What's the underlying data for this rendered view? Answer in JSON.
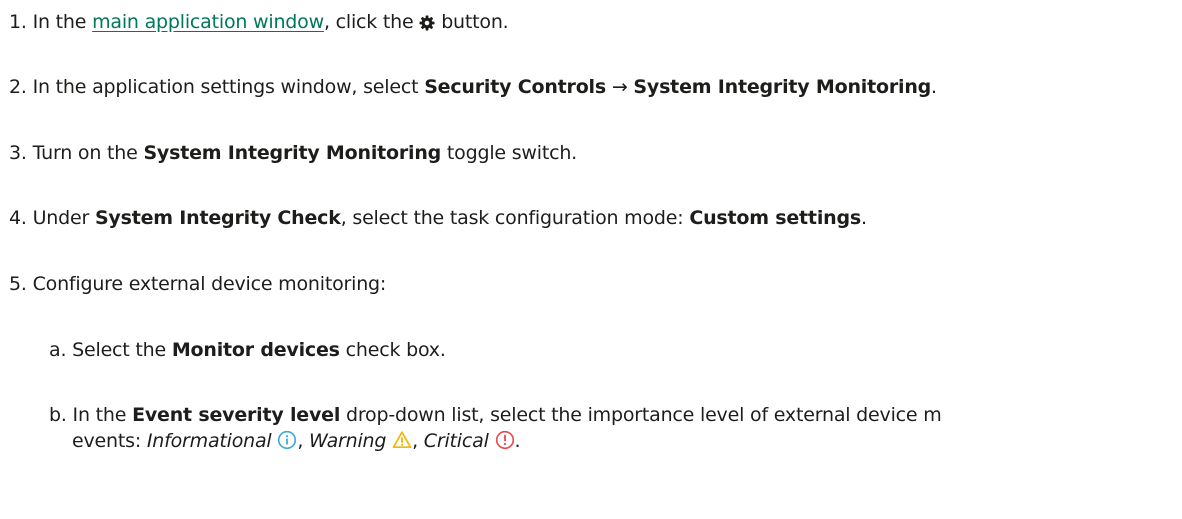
{
  "steps": {
    "s1": {
      "num": "1.",
      "pre": "In the",
      "link": "main application window",
      "post1": ", click the",
      "icon": "gear-icon",
      "post2": "button."
    },
    "s2": {
      "num": "2.",
      "pre": "In the application settings window, select",
      "b1": "Security Controls",
      "arrow": "→",
      "b2": "System Integrity Monitoring",
      "post": "."
    },
    "s3": {
      "num": "3.",
      "pre": "Turn on the",
      "b1": "System Integrity Monitoring",
      "post": "toggle switch."
    },
    "s4": {
      "num": "4.",
      "pre": "Under",
      "b1": "System Integrity Check",
      "mid": ", select the task configuration mode:",
      "b2": "Custom settings",
      "post": "."
    },
    "s5": {
      "num": "5.",
      "text": "Configure external device monitoring:"
    },
    "sa": {
      "num": "a.",
      "pre": "Select the",
      "b1": "Monitor devices",
      "post": "check box."
    },
    "sb": {
      "num": "b.",
      "pre": "In the",
      "b1": "Event severity level",
      "post": "drop-down list, select the importance level of external device m",
      "cont_pre": "events:",
      "levels": [
        {
          "name": "Informational",
          "icon": "info-icon",
          "color": "#3aa9d8"
        },
        {
          "name": "Warning",
          "icon": "warning-icon",
          "color": "#f2b705"
        },
        {
          "name": "Critical",
          "icon": "critical-icon",
          "color": "#e5484d"
        }
      ],
      "sep": ",",
      "end": "."
    }
  }
}
